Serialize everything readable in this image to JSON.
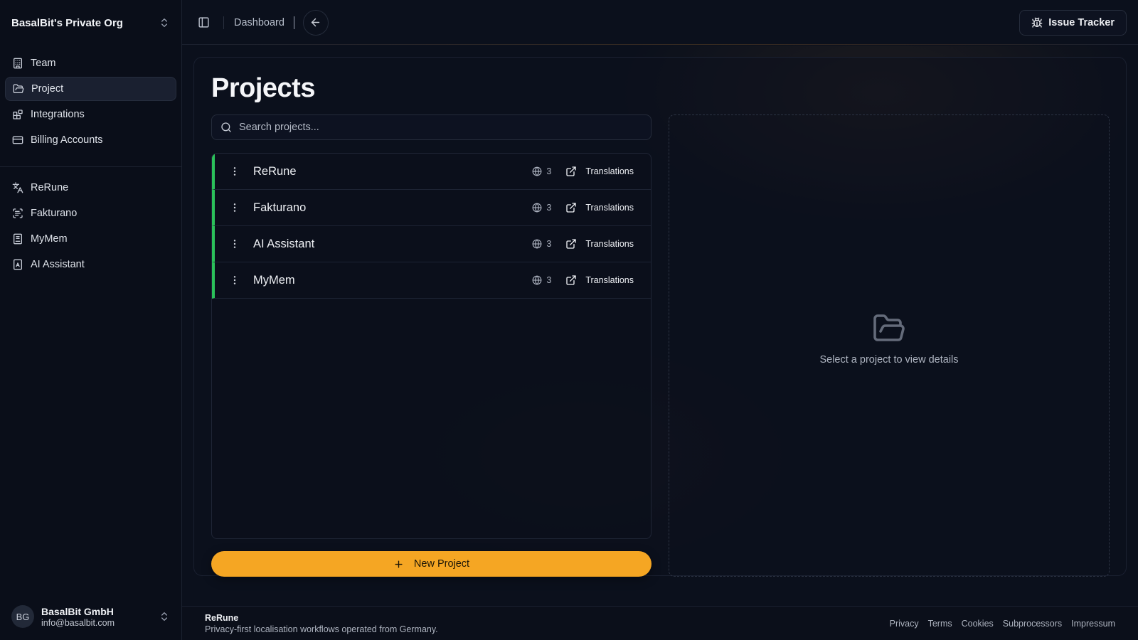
{
  "sidebar": {
    "org_name": "BasalBit's Private Org",
    "nav": [
      {
        "label": "Team",
        "icon": "building-icon"
      },
      {
        "label": "Project",
        "icon": "folder-open-icon",
        "active": true
      },
      {
        "label": "Integrations",
        "icon": "blocks-icon"
      },
      {
        "label": "Billing Accounts",
        "icon": "credit-card-icon"
      }
    ],
    "apps": [
      {
        "label": "ReRune",
        "icon": "languages-icon"
      },
      {
        "label": "Fakturano",
        "icon": "scan-text-icon"
      },
      {
        "label": "MyMem",
        "icon": "notebook-icon"
      },
      {
        "label": "AI Assistant",
        "icon": "bot-square-icon"
      }
    ],
    "user": {
      "initials": "BG",
      "name": "BasalBit GmbH",
      "email": "info@basalbit.com"
    }
  },
  "topbar": {
    "breadcrumb": "Dashboard",
    "issue_tracker_label": "Issue Tracker"
  },
  "main": {
    "title": "Projects",
    "search_placeholder": "Search projects...",
    "projects": [
      {
        "name": "ReRune",
        "languages": "3",
        "action": "Translations"
      },
      {
        "name": "Fakturano",
        "languages": "3",
        "action": "Translations"
      },
      {
        "name": "AI Assistant",
        "languages": "3",
        "action": "Translations"
      },
      {
        "name": "MyMem",
        "languages": "3",
        "action": "Translations"
      }
    ],
    "new_project_label": "New Project",
    "empty_detail": "Select a project to view details",
    "accent_color": "#f5a623",
    "row_status_color": "#2bc15a"
  },
  "footer": {
    "title": "ReRune",
    "subtitle": "Privacy-first localisation workflows operated from Germany.",
    "links": [
      "Privacy",
      "Terms",
      "Cookies",
      "Subprocessors",
      "Impressum"
    ]
  }
}
